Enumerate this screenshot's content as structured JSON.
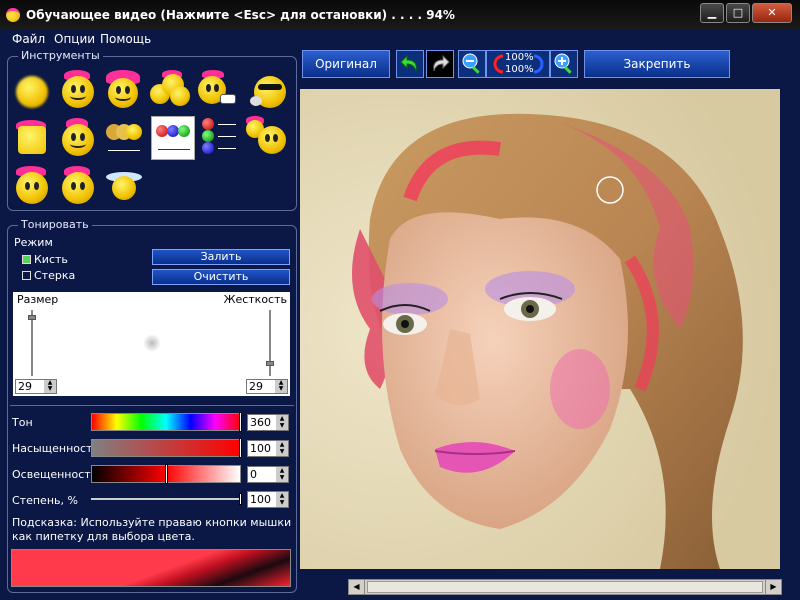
{
  "window": {
    "title": "Обучающее видео (Нажмите <Esc> для остановки) . . . . 94%",
    "buttons": {
      "minimize": "▁",
      "maximize": "□",
      "close": "✕"
    }
  },
  "menu": {
    "items": [
      "Файл",
      "Опции",
      "Помощь"
    ]
  },
  "tools_group": {
    "label": "Инструменты"
  },
  "tint_group": {
    "label": "Тонировать",
    "mode_label": "Режим",
    "brush_label": "Кисть",
    "eraser_label": "Стерка",
    "brush_checked": true,
    "eraser_checked": false,
    "fill_button": "Залить",
    "clear_button": "Очистить",
    "size_label": "Размер",
    "hardness_label": "Жесткость",
    "size_value": "29",
    "hardness_value": "29",
    "size_level": 0.9,
    "hardness_level": 0.2
  },
  "color_controls": {
    "hue_label": "Тон",
    "hue_value": "360",
    "saturation_label": "Насыщенность",
    "saturation_value": "100",
    "lightness_label": "Освещенность",
    "lightness_value": "0",
    "degree_label": "Степень, %",
    "degree_value": "100"
  },
  "hint": "Подсказка: Используйте праваю кнопки мышки как пипетку для выбора цвета.",
  "toolbar": {
    "original_button": "Оригинал",
    "zoom_in_text": "100%",
    "zoom_out_text": "100%",
    "apply_button": "Закрепить"
  },
  "colors": {
    "panel_bg": "#0b1745",
    "accent_blue": "#1f55c8",
    "hair_pink": "#ff2f98",
    "tint_red": "#ff1a1a"
  }
}
